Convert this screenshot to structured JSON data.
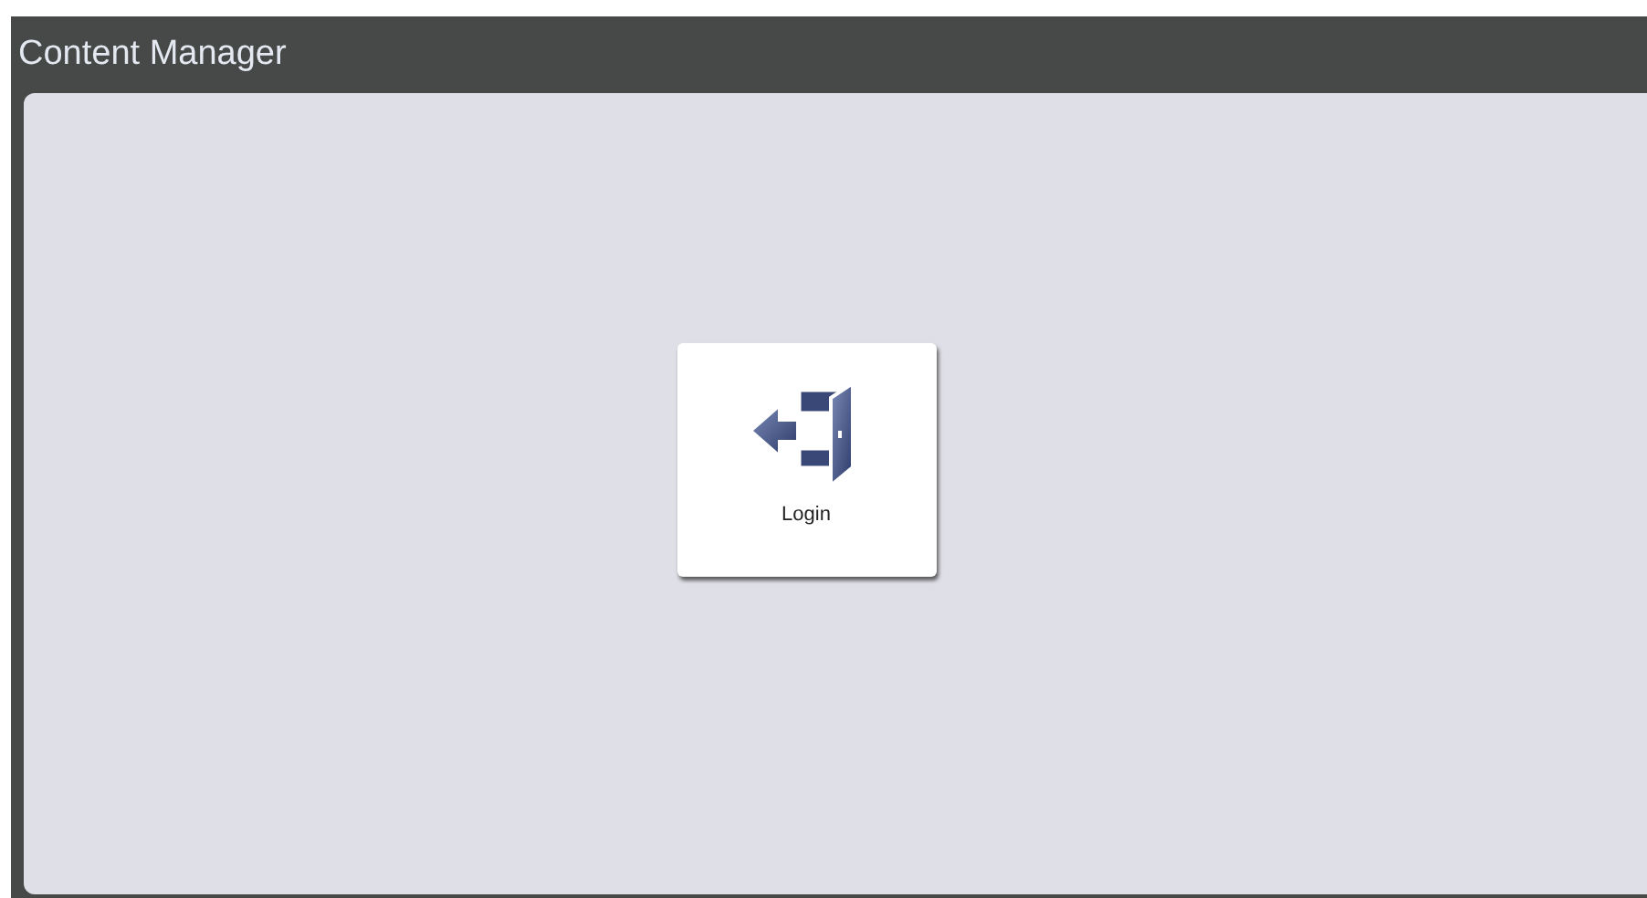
{
  "window": {
    "title": "Content Manager"
  },
  "tiles": [
    {
      "label": "Login"
    }
  ]
}
